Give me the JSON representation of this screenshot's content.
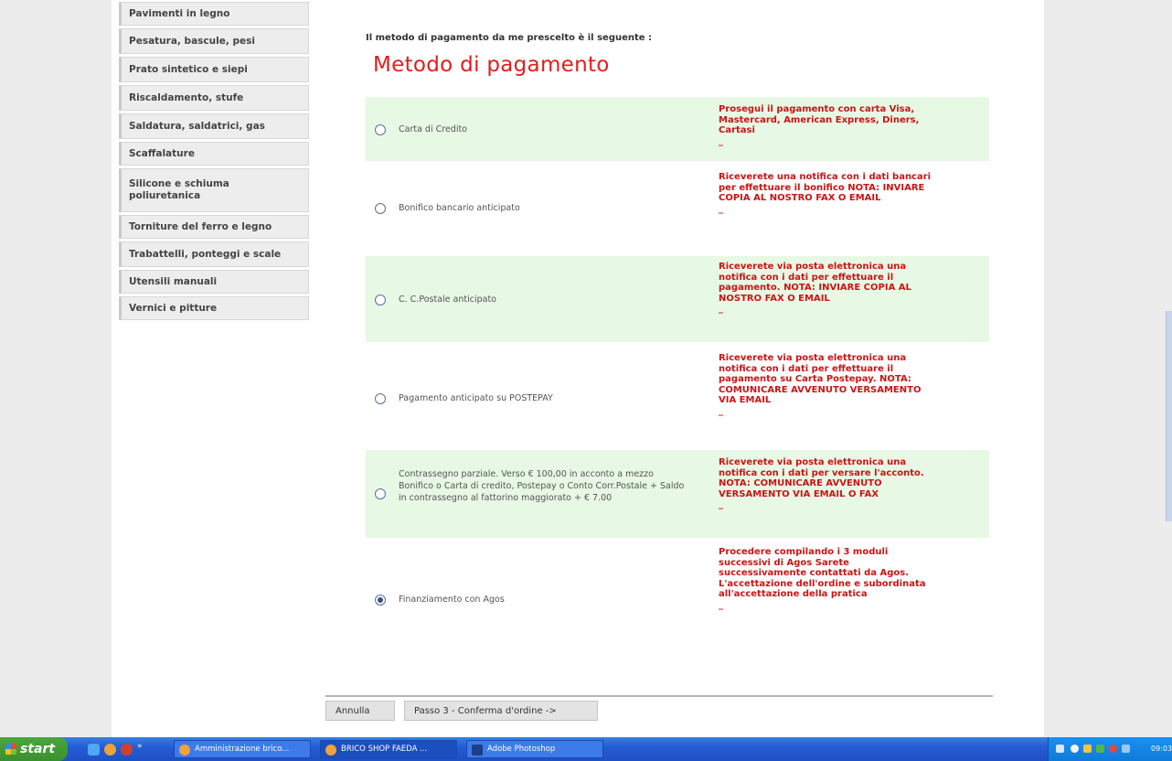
{
  "sidebar": {
    "categories": [
      "Pavimenti in legno",
      "Pesatura, bascule, pesi",
      "Prato sintetico e siepi",
      "Riscaldamento, stufe",
      "Saldatura, saldatrici, gas",
      "Scaffalature",
      "Silicone e schiuma poliuretanica",
      "Torniture del ferro e legno",
      "Trabattelli, ponteggi e scale",
      "Utensili manuali",
      "Vernici e pitture"
    ]
  },
  "main": {
    "intro": "Il metodo di pagamento da me prescelto è il seguente :",
    "title": "Metodo di pagamento",
    "options": [
      {
        "label": "Carta di Credito",
        "selected": false,
        "description": "Prosegui il pagamento con carta Visa, Mastercard, American Express, Diners, Cartasi",
        "dash": "_"
      },
      {
        "label": "Bonifico bancario anticipato",
        "selected": false,
        "description": "Riceverete una notifica con i dati bancari per effettuare il bonifico NOTA: INVIARE COPIA AL NOSTRO FAX O EMAIL",
        "dash": "_"
      },
      {
        "label": "C. C.Postale anticipato",
        "selected": false,
        "description": "Riceverete via posta elettronica una notifica con i dati per effettuare il pagamento. NOTA: INVIARE COPIA AL NOSTRO FAX O EMAIL",
        "dash": "_"
      },
      {
        "label": "Pagamento anticipato su POSTEPAY",
        "selected": false,
        "description": "Riceverete via posta elettronica una notifica con i dati per effettuare il pagamento su Carta Postepay. NOTA: COMUNICARE AVVENUTO VERSAMENTO VIA EMAIL",
        "dash": "_"
      },
      {
        "label": "Contrassegno parziale. Verso € 100,00 in acconto a mezzo Bonifico o Carta di credito, Postepay o Conto Corr.Postale + Saldo in contrassegno al fattorino maggiorato + € 7.00",
        "selected": false,
        "description": "Riceverete via posta elettronica una notifica con i dati per versare l'acconto. NOTA: COMUNICARE AVVENUTO VERSAMENTO VIA EMAIL O FAX",
        "dash": "_"
      },
      {
        "label": "Finanziamento con Agos",
        "selected": true,
        "description": "Procedere compilando i 3 moduli successivi di Agos Sarete successivamente contattati da Agos. L'accettazione dell'ordine e subordinata all'accettazione della pratica",
        "dash": "_"
      }
    ],
    "buttons": {
      "cancel": "Annulla",
      "next": "Passo 3 - Conferma d'ordine ->"
    }
  },
  "taskbar": {
    "start": "start",
    "tasks": [
      "Amministrazione brico...",
      "BRICO SHOP FAEDA ...",
      "Adobe Photoshop"
    ],
    "clock": "09:03"
  },
  "colors": {
    "accent_red": "#e21d1d",
    "option_green": "#e7f8e4",
    "taskbar_blue": "#245dd7",
    "start_green": "#3c8f30"
  }
}
